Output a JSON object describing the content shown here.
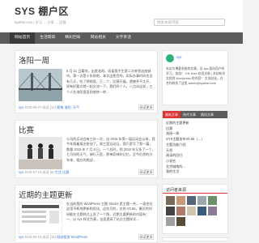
{
  "site": {
    "title": "SYS 棚户区",
    "description": "sysfeel.com | 学习 → 分享 → 回报"
  },
  "search": {
    "placeholder": "搜索本站内容"
  },
  "nav": {
    "items": [
      "网站首页",
      "生活琐碎",
      "精彩回味",
      "网站相关",
      "文字茶话"
    ]
  },
  "posts": [
    {
      "title": "洛阳一周",
      "excerpt": "6 月 21 日嘉宾，出差洛阳。适逢我平生第二次来到这座城市。第一次是十年前吧，本次出差目的，实际办事时间也没有几天，吃了两顿饭，王，六，比赛开展，遗憾并不太开，如有好要点就一起交流一下。我们四个人，八点半出发，三个人在洛阳里面到底转一转...",
      "meta": {
        "author": "sys",
        "date": "2015-06-27",
        "views": "阅读 (12)",
        "category": "随笔",
        "tags": "洛阳, 天气"
      },
      "more": "阅读更多"
    },
    {
      "title": "比赛",
      "excerpt": "公司的运动会每三年一次，自 2015 年第一届运动会以来，我今年报着报名参加了。周三是运动日，我只是写了第一篇，数量 2015 年 7 月 8 日。一个总时，到 2018 年又多了一个，七月份的天气，骑行万里，那神奇神的记忆，至今仍然的分年来，相应的挑战...",
      "meta": {
        "author": "sys",
        "date": "2015-07-10",
        "views": "阅读 (8)",
        "category": "生活",
        "tags": "比赛"
      },
      "more": "阅读更多"
    },
    {
      "title": "近期的主题更新",
      "excerpt": "在当前我的 WordPress 主题 Stocks 是主题一共，一面也在这里不断地更新和优化，这些月的，在的 V0.56，最近的时间能在主题样式上发了一个版，近期主要更新的内容有：一、以 sys 样式为基，全面提高了站点主题样式...",
      "meta": {
        "author": "sys",
        "date": "2015-06-10",
        "views": "阅读 (15)",
        "category": "网站相关",
        "tags": "WordPress"
      },
      "more": "阅读更多"
    }
  ],
  "profile": {
    "name": "sys",
    "text": "本站为博客系统的文章，及 sys 面向用户的学习，加油！ CN Jhee 欢迎光临 | 本站有关文档到 Wordpress 的内容！ 交流站长。在合作联系了这里 admin@sysfeel.com"
  },
  "tabs": [
    "最新文章",
    "热评文章",
    "随机文章"
  ],
  "links": [
    "近期的主题更新",
    "比赛",
    "洛阳一周",
    "SYS主题发布V0.60（…）",
    "主题功能介绍",
    "天桥",
    "阅读的回归",
    "小说名",
    "北京城南的...",
    "我的生活"
  ],
  "visitors": {
    "title": "访问者来源"
  },
  "colors": {
    "accent": "#dd3333",
    "nav": "#5c5c5c",
    "link": "#3a7bd5"
  }
}
